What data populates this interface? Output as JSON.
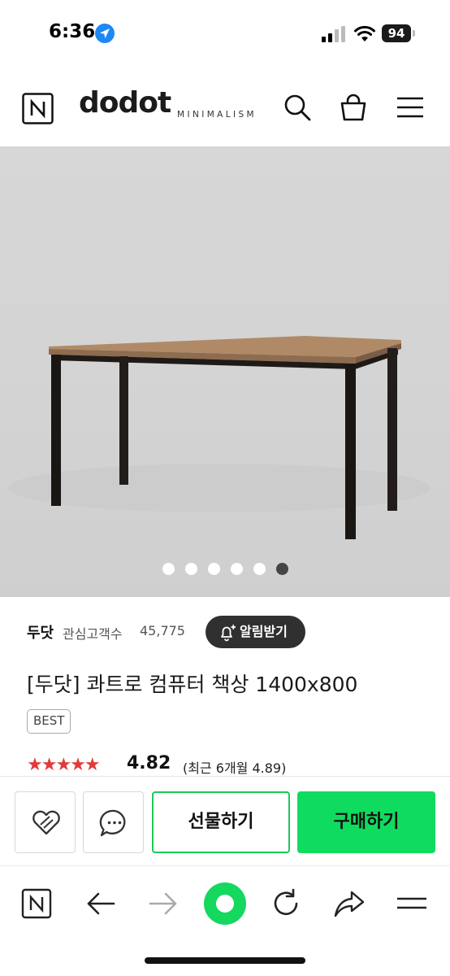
{
  "status": {
    "time": "6:36",
    "battery": "94"
  },
  "brand": {
    "name": "dodot",
    "tagline": "MINIMALISM",
    "n_badge": "N"
  },
  "carousel": {
    "count": 6,
    "active_index": 5
  },
  "seller": {
    "name": "두닷",
    "follower_label": "관심고객수",
    "follower_count": "45,775",
    "notify_label": "알림받기"
  },
  "product": {
    "title": "[두닷] 콰트로 컴퓨터 책상 1400x800",
    "badge": "BEST",
    "stars": "★★★★★",
    "rating": "4.82",
    "recent_rating": "(최근 6개월 4.89)"
  },
  "actions": {
    "gift_label": "선물하기",
    "buy_label": "구매하기"
  },
  "colors": {
    "accent_green": "#0fdc5f",
    "star_red": "#e23a3a",
    "dark_button": "#303030"
  },
  "icons": [
    "location-arrow-icon",
    "signal-icon",
    "wifi-icon",
    "n-logo-icon",
    "search-icon",
    "shopping-bag-icon",
    "menu-icon",
    "bell-plus-icon",
    "heart-icon",
    "chat-icon",
    "back-arrow-icon",
    "forward-arrow-icon",
    "reload-icon",
    "share-icon",
    "tabs-icon"
  ]
}
